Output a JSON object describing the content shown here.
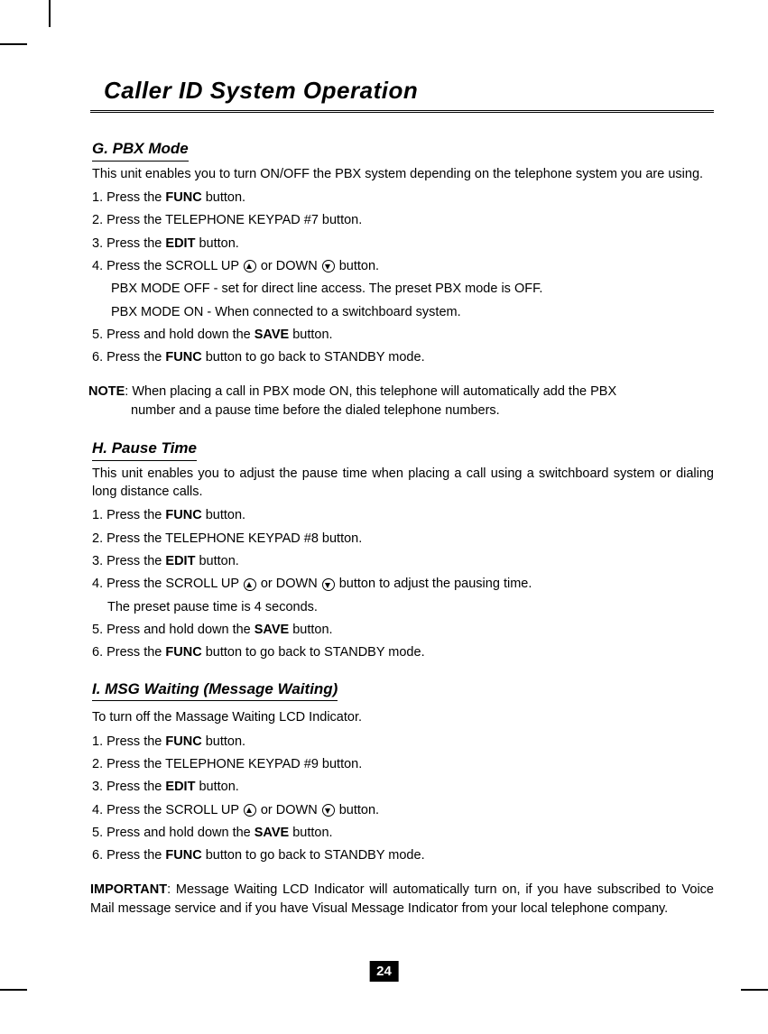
{
  "page_title": "Caller ID System Operation",
  "page_number": "24",
  "sections": {
    "g": {
      "heading": "G. PBX Mode",
      "intro": "This unit enables you to turn ON/OFF the PBX system depending on the telephone system you are using.",
      "step1a": "1. Press the ",
      "step1b": "FUNC",
      "step1c": " button.",
      "step2": "2. Press the TELEPHONE KEYPAD #7 button.",
      "step3a": "3. Press the ",
      "step3b": "EDIT",
      "step3c": " button.",
      "step4a": "4. Press the SCROLL UP ",
      "step4b": " or DOWN ",
      "step4c": " button.",
      "step4sub1": "PBX MODE OFF - set for direct line access. The preset PBX mode is OFF.",
      "step4sub2": "PBX MODE ON - When connected to a switchboard system.",
      "step5a": "5. Press and hold down the ",
      "step5b": "SAVE",
      "step5c": " button.",
      "step6a": "6. Press the ",
      "step6b": "FUNC",
      "step6c": " button to go back to STANDBY mode."
    },
    "note": {
      "label": "NOTE",
      "text1": ": When placing a call in PBX mode ON, this telephone will automatically add the PBX",
      "text2": "number and a pause time before the dialed telephone numbers."
    },
    "h": {
      "heading": "H. Pause Time",
      "intro": "This unit enables you to adjust the pause time when placing a call using a switchboard system or dialing long distance calls.",
      "step1a": "1. Press the ",
      "step1b": "FUNC",
      "step1c": " button.",
      "step2": "2. Press the TELEPHONE KEYPAD #8 button.",
      "step3a": "3. Press the ",
      "step3b": "EDIT",
      "step3c": " button.",
      "step4a": "4. Press the SCROLL UP ",
      "step4b": " or DOWN ",
      "step4c": " button to adjust the pausing time.",
      "step4sub": "The preset pause time is 4 seconds.",
      "step5a": "5. Press and hold down the ",
      "step5b": "SAVE",
      "step5c": " button.",
      "step6a": "6. Press the ",
      "step6b": "FUNC",
      "step6c": " button to go back to STANDBY mode."
    },
    "i": {
      "heading": "I. MSG Waiting (Message Waiting)",
      "intro": "To turn off the Massage Waiting LCD Indicator.",
      "step1a": "1. Press the ",
      "step1b": "FUNC",
      "step1c": " button.",
      "step2": "2. Press the TELEPHONE KEYPAD #9 button.",
      "step3a": "3. Press the ",
      "step3b": "EDIT",
      "step3c": " button.",
      "step4a": "4. Press the SCROLL UP ",
      "step4b": " or DOWN ",
      "step4c": " button.",
      "step5a": "5. Press and hold down the ",
      "step5b": "SAVE",
      "step5c": " button.",
      "step6a": "6. Press the ",
      "step6b": "FUNC",
      "step6c": " button to go back to STANDBY mode."
    },
    "important": {
      "label": "IMPORTANT",
      "text": ": Message Waiting LCD Indicator will automatically turn on, if you have subscribed to Voice Mail message service and if you have Visual Message Indicator from your local telephone company."
    }
  }
}
